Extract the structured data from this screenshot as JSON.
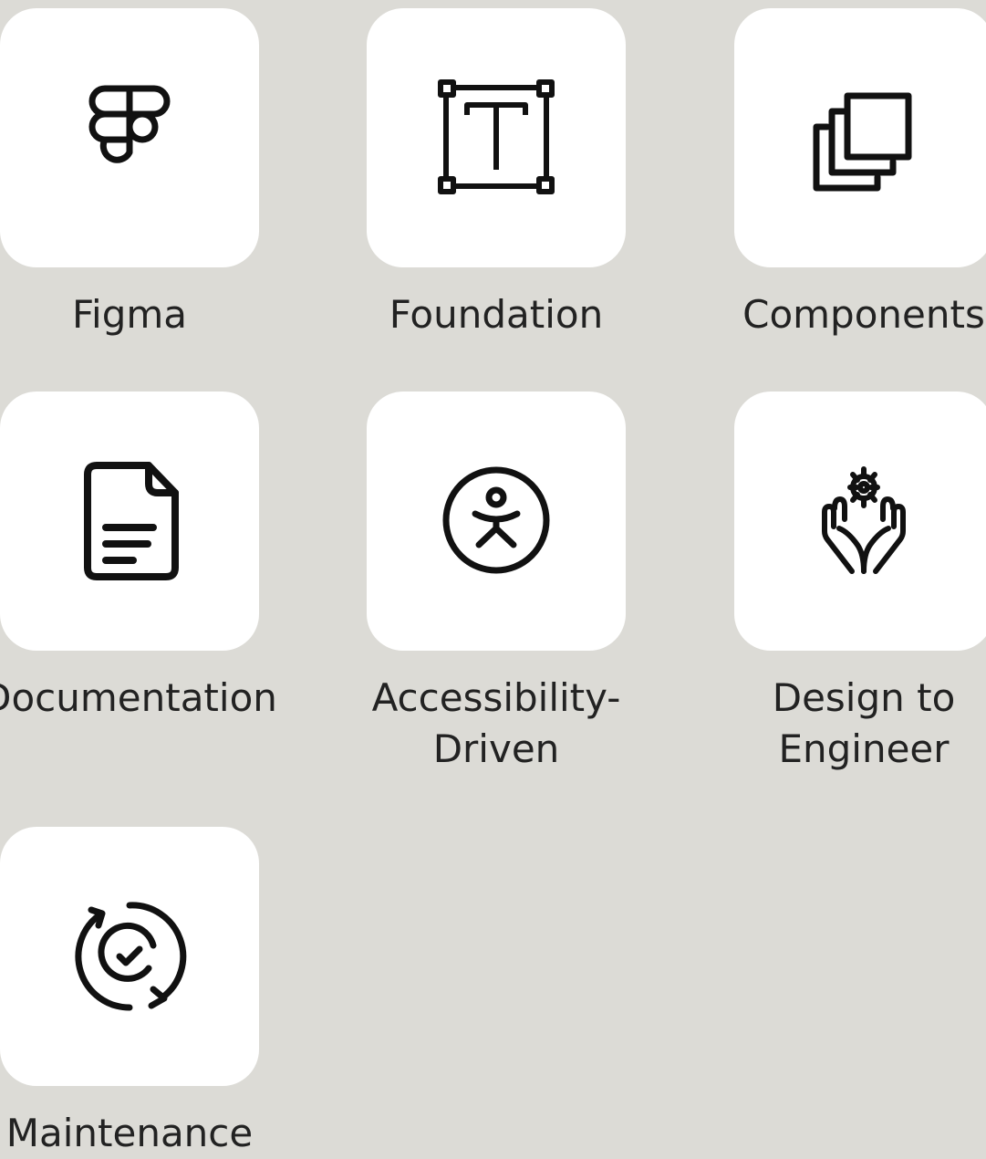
{
  "tiles": [
    {
      "label": "Figma",
      "icon": "figma-icon"
    },
    {
      "label": "Foundation",
      "icon": "text-frame-icon"
    },
    {
      "label": "Components",
      "icon": "layers-icon"
    },
    {
      "label": "Documentation",
      "icon": "document-icon"
    },
    {
      "label": "Accessibility-Driven",
      "icon": "accessibility-icon"
    },
    {
      "label": "Design to Engineer",
      "icon": "hands-gear-icon"
    },
    {
      "label": "Maintenance",
      "icon": "sync-check-icon"
    }
  ],
  "colors": {
    "background": "#dcdbd6",
    "card": "#ffffff",
    "icon": "#111111",
    "text": "#222222"
  }
}
